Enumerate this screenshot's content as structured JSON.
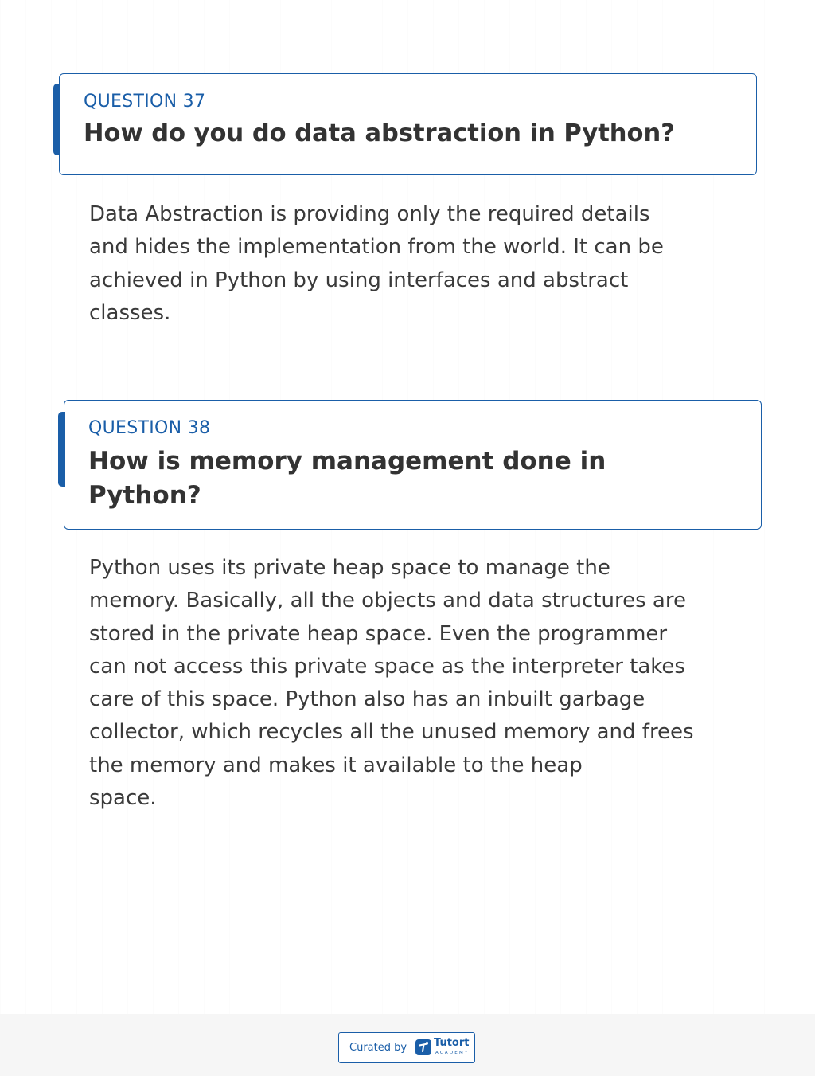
{
  "questions": [
    {
      "number_label": "QUESTION 37",
      "title_lines": [
        "How do you do data abstraction in Python?"
      ],
      "answer_lines": [
        "Data Abstraction is providing only the required details",
        "and hides the implementation from the world. It can be",
        "achieved in Python by using interfaces and abstract",
        "classes."
      ]
    },
    {
      "number_label": "QUESTION 38",
      "title_lines": [
        "How is memory management done in",
        "Python?"
      ],
      "answer_lines": [
        "Python uses its private heap space to manage the",
        "memory. Basically, all the objects and data structures are",
        "stored in the private heap space. Even the programmer",
        "can not access this private space as the interpreter takes",
        "care of this space. Python also has an inbuilt garbage",
        "collector, which recycles all the unused memory and frees",
        "the memory and makes it available to the heap",
        "space."
      ]
    }
  ],
  "footer": {
    "curated_label": "Curated by",
    "brand_name": "Tutort",
    "brand_subtitle": "ACADEMY",
    "logo_icon": "tutort-logo-icon"
  },
  "colors": {
    "accent": "#1a5ea8",
    "heading_text": "#333333",
    "body_text": "#3a3a3a",
    "footer_bg": "#f6f6f6"
  }
}
